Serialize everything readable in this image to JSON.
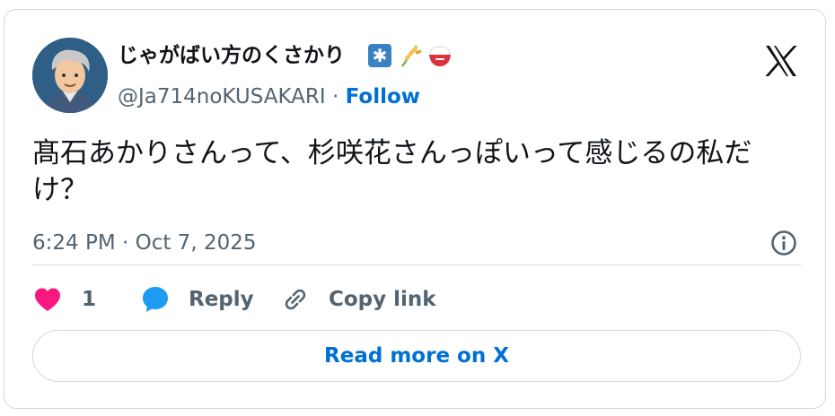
{
  "author": {
    "display_name": "じゃがばい方のくさかり",
    "badges": [
      "snowflake-badge",
      "rice-plant-emoji",
      "rice-bowl-emoji"
    ],
    "badge_snowflake": "✱",
    "handle": "@Ja714noKUSAKARI",
    "separator": " · ",
    "follow_label": "Follow"
  },
  "tweet": {
    "text": "髙石あかりさんって、杉咲花さんっぽいって感じるの私だけ？",
    "timestamp": "6:24 PM · Oct 7, 2025"
  },
  "actions": {
    "like_count": "1",
    "reply_label": "Reply",
    "copy_link_label": "Copy link"
  },
  "read_more_label": "Read more on X",
  "colors": {
    "link_blue": "#006fd6",
    "like_pink": "#f91880",
    "reply_blue": "#1d9bf0",
    "muted_gray": "#536471",
    "border": "#cfd9de"
  }
}
